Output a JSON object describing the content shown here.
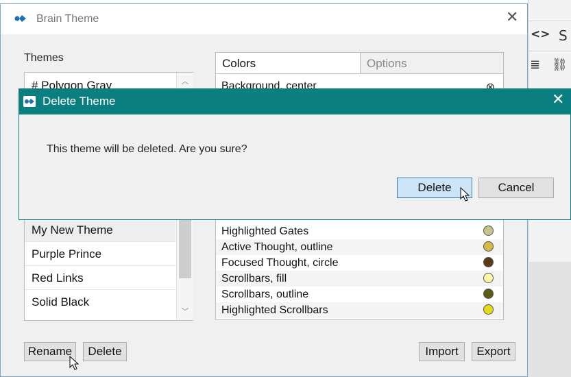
{
  "main_window": {
    "title": "Brain Theme",
    "close_glyph": "✕",
    "themes_label": "Themes",
    "themes": [
      {
        "label": "# Polygon Gray"
      },
      {
        "label": "My New Theme",
        "selected": true
      },
      {
        "label": "Purple Prince"
      },
      {
        "label": "Red Links"
      },
      {
        "label": "Solid Black"
      }
    ],
    "tabs": {
      "colors": "Colors",
      "options": "Options"
    },
    "colors": [
      {
        "label": "Background, center",
        "clear_glyph": "⊗"
      },
      {
        "label": "Highlighted Gates",
        "swatch": "#c9c28a"
      },
      {
        "label": "Active Thought, outline",
        "swatch": "#d4b94a"
      },
      {
        "label": "Focused Thought, circle",
        "swatch": "#5c3a17"
      },
      {
        "label": "Scrollbars, fill",
        "swatch": "#fbf8a6"
      },
      {
        "label": "Scrollbars, outline",
        "swatch": "#5c5a14"
      },
      {
        "label": "Highlighted Scrollbars",
        "swatch": "#e6da1a"
      }
    ],
    "buttons": {
      "rename": "Rename",
      "delete": "Delete",
      "import": "Import",
      "export": "Export"
    }
  },
  "dialog": {
    "title": "Delete Theme",
    "close_glyph": "✕",
    "message": "This theme will be deleted. Are you sure?",
    "delete_label": "Delete",
    "cancel_label": "Cancel"
  },
  "colors": {
    "dialog_title_bar": "#0b7f80",
    "primary_button": "#cce4f7",
    "app_icon": "#1f6fb5"
  },
  "background_app": {
    "icons": [
      "code-tag-icon",
      "strikethrough-icon",
      "list-icon",
      "link-icon"
    ]
  }
}
